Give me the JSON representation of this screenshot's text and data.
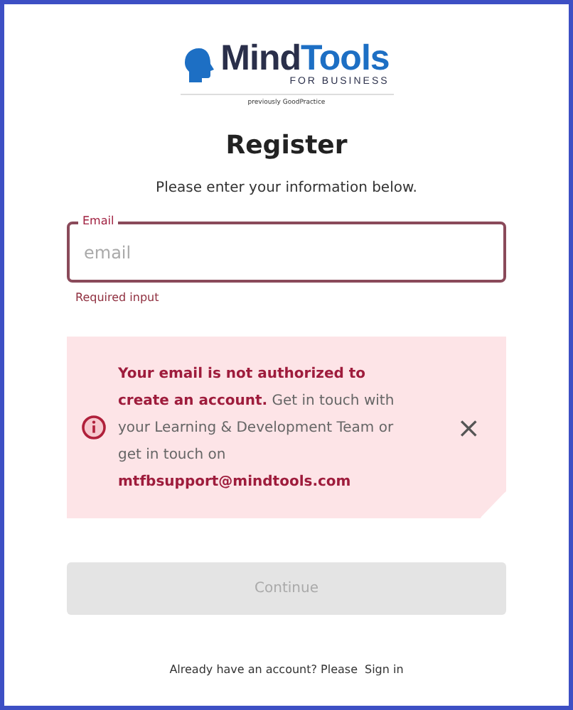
{
  "logo": {
    "name_first": "Mind",
    "name_second": "Tools",
    "tagline": "FOR BUSINESS",
    "note": "previously GoodPractice"
  },
  "title": "Register",
  "subtitle": "Please enter your information below.",
  "email_field": {
    "label": "Email",
    "placeholder": "email",
    "error": true,
    "error_text": "Required input"
  },
  "alert": {
    "text": "**Your email is not authorized to create an account.** Get in touch with your Learning & Development Team or get in touch on **mtfbsupport@mindtools.com**",
    "close": "×"
  },
  "continue_button": {
    "label": "Continue",
    "disabled": true
  },
  "footer": {
    "text": "Already have an account? Please",
    "link": "Sign in"
  }
}
